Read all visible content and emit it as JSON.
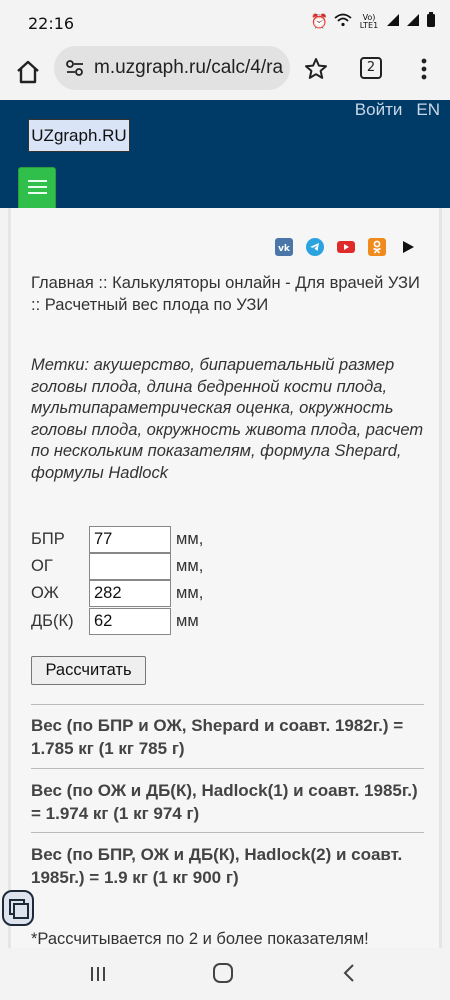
{
  "status": {
    "time": "22:16",
    "network": "Vo) LTE1"
  },
  "browser": {
    "url": "m.uzgraph.ru/calc/4/ra",
    "tab_count": "2"
  },
  "header": {
    "login": "Войти",
    "lang": "EN",
    "logo": "UZgraph.RU"
  },
  "breadcrumb": "Главная :: Калькуляторы онлайн - Для врачей УЗИ :: Расчетный вес плода по УЗИ",
  "tags": "Метки: акушерство, бипариетальный размер головы плода, длина бедренной кости плода, мультипараметрическая оценка, окружность головы плода, окружность живота плода, расчет по нескольким показателям, формула Shepard, формулы Hadlock",
  "form": {
    "rows": [
      {
        "label": "БПР",
        "value": "77",
        "unit": "мм,"
      },
      {
        "label": "ОГ",
        "value": "",
        "unit": "мм,"
      },
      {
        "label": "ОЖ",
        "value": "282",
        "unit": "мм,"
      },
      {
        "label": "ДБ(К)",
        "value": "62",
        "unit": "мм"
      }
    ],
    "button": "Рассчитать"
  },
  "results": [
    "Вес (по БПР и ОЖ, Shepard и соавт. 1982г.) = 1.785 кг (1 кг 785 г)",
    "Вес (по ОЖ и ДБ(К), Hadlock(1) и соавт. 1985г.) = 1.974 кг (1 кг 974 г)",
    "Вес (по БПР, ОЖ и ДБ(К), Hadlock(2) и соавт. 1985г.) = 1.9 кг (1 кг 900 г)"
  ],
  "note": "*Рассчитывается по 2 и более показателям!",
  "social_icons": [
    "vk-icon",
    "telegram-icon",
    "youtube-icon",
    "odnoklassniki-icon",
    "play-icon"
  ],
  "colors": {
    "header_bg": "#003a66",
    "menu_green": "#2fbf4a",
    "content_bg": "#f6f6f6"
  }
}
